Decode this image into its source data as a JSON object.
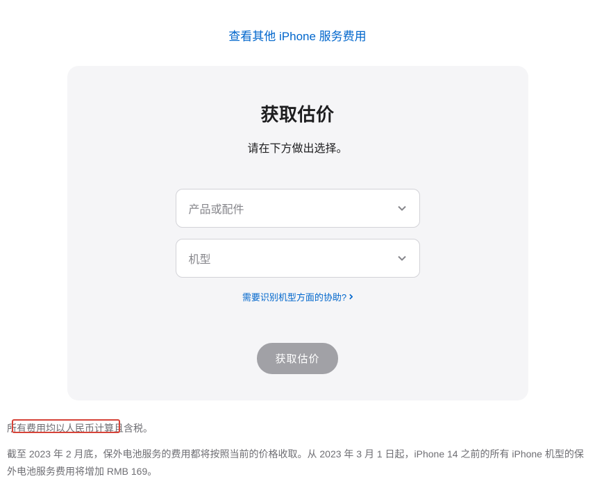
{
  "topLink": "查看其他 iPhone 服务费用",
  "card": {
    "title": "获取估价",
    "subtitle": "请在下方做出选择。",
    "select1": {
      "placeholder": "产品或配件"
    },
    "select2": {
      "placeholder": "机型"
    },
    "helpLink": "需要识别机型方面的协助?",
    "button": "获取估价"
  },
  "notes": {
    "line1": "所有费用均以人民币计算且含税。",
    "line2": "截至 2023 年 2 月底，保外电池服务的费用都将按照当前的价格收取。从 2023 年 3 月 1 日起，iPhone 14 之前的所有 iPhone 机型的保外电池服务费用将增加 RMB 169。"
  }
}
